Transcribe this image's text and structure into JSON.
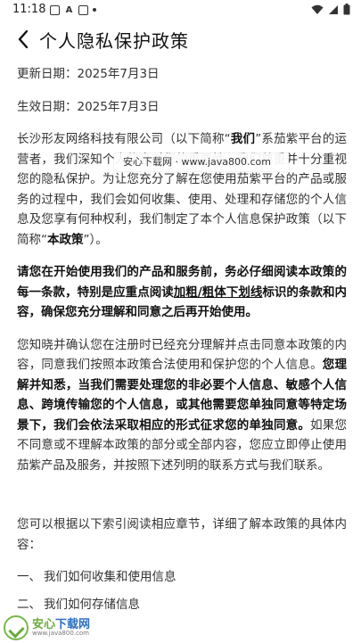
{
  "status_bar": {
    "time": "11:18",
    "left_icons": [
      "image-icon",
      "a-icon",
      "photo-icon",
      "dot-icon"
    ],
    "right_icons": [
      "wifi-icon",
      "signal-icon",
      "battery-icon"
    ]
  },
  "header": {
    "back_icon": "chevron-left-icon",
    "title": "个人隐私保护政策"
  },
  "content": {
    "update_date": "更新日期：2025年7月3日",
    "effective_date": "生效日期：2025年7月3日",
    "intro": {
      "p1": "长沙形友网络科技有限公司（以下简称“",
      "we": "我们",
      "p2": "”系茄紫平台的运营者，我们深知个人信息对您的重要性，我们尊重并十分重视您的隐私保护。为让您充分了解在您使用茄紫平台的产品或服务的过程中，我们会如何收集、使用、处理和存储您的个人信息及您享有何种权利，我们制定了本个人信息保护政策（以下简称“",
      "policy": "本政策",
      "p3": "”）。"
    },
    "notice": {
      "p1": "请您在开始使用我们的产品和服务前，务必仔细阅读本政策的每一条款，特别是应重点阅读",
      "underline": "加粗/粗体下划线",
      "p2": "标识的条款和内容，确保您充分理解和同意之后再开始使用。"
    },
    "consent": {
      "p1": "您知晓并确认您在注册时已经充分理解并点击同意本政策的内容，同意我们按照本政策合法使用和保护您的个人信息。",
      "bold": "您理解并知悉，当我们需要处理您的非必要个人信息、敏感个人信息、跨境传输您的个人信息，或其他需要您单独同意等特定场景下，我们会依法采取相应的形式征求您的单独同意。",
      "p2": "如果您不同意或不理解本政策的部分或全部内容，您应立即停止使用茄紫产品及服务，并按照下述列明的联系方式与我们联系。"
    },
    "toc_intro": "您可以根据以下索引阅读相应章节，详细了解本政策的具体内容：",
    "toc": [
      {
        "num": "一、",
        "label": "我们如何收集和使用信息"
      },
      {
        "num": "二、",
        "label": "我们如何存储信息"
      }
    ]
  },
  "watermark": {
    "text": "安心下载网 · www.java800.com"
  },
  "logo_watermark": {
    "name_part1": "安心",
    "name_part2": "下载网",
    "url": "www.java800.com"
  }
}
